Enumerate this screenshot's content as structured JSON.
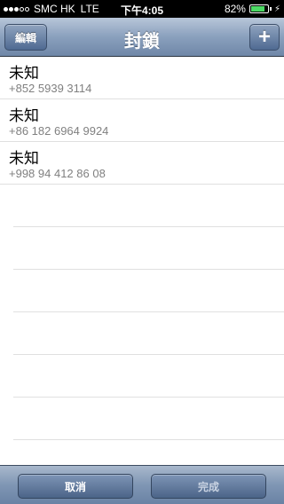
{
  "status_bar": {
    "signal_dots_filled": 3,
    "signal_dots_total": 5,
    "carrier": "SMC HK",
    "network": "LTE",
    "time": "下午4:05",
    "battery_percent": "82%",
    "battery_level": 0.82
  },
  "nav": {
    "title": "封鎖",
    "edit_label": "編輯",
    "add_label": "+"
  },
  "entries": [
    {
      "name": "未知",
      "number": "+852 5939 3114"
    },
    {
      "name": "未知",
      "number": "+86 182 6964 9924"
    },
    {
      "name": "未知",
      "number": "+998 94 412 86 08"
    }
  ],
  "toolbar": {
    "cancel_label": "取消",
    "done_label": "完成"
  }
}
